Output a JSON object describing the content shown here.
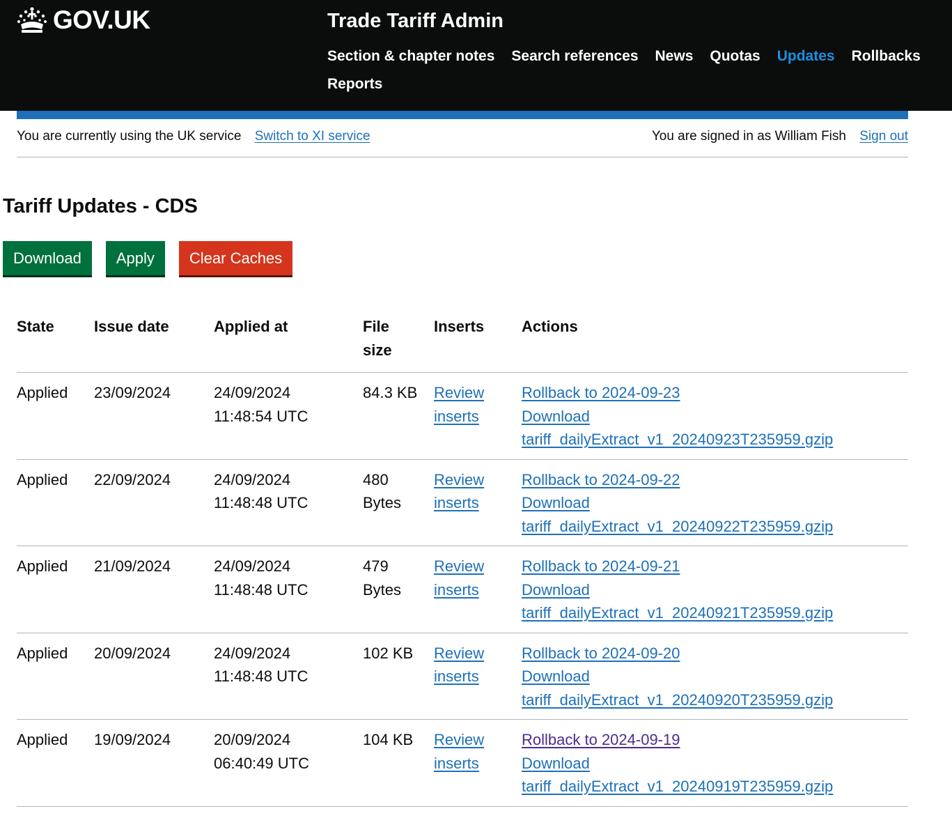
{
  "header": {
    "logo_text": "GOV.UK",
    "service_name": "Trade Tariff Admin",
    "nav": [
      {
        "label": "Section & chapter notes",
        "active": false
      },
      {
        "label": "Search references",
        "active": false
      },
      {
        "label": "News",
        "active": false
      },
      {
        "label": "Quotas",
        "active": false
      },
      {
        "label": "Updates",
        "active": true
      },
      {
        "label": "Rollbacks",
        "active": false
      },
      {
        "label": "Reports",
        "active": false
      }
    ]
  },
  "service_bar": {
    "current_service_text": "You are currently using the UK service",
    "switch_link": "Switch to XI service",
    "signed_in_text": "You are signed in as William Fish",
    "sign_out_link": "Sign out"
  },
  "page": {
    "title": "Tariff Updates - CDS",
    "buttons": {
      "download": "Download",
      "apply": "Apply",
      "clear_caches": "Clear Caches"
    }
  },
  "table": {
    "headers": {
      "state": "State",
      "issue_date": "Issue date",
      "applied_at": "Applied at",
      "file_size": "File size",
      "inserts": "Inserts",
      "actions": "Actions"
    },
    "rows": [
      {
        "state": "Applied",
        "issue_date": "23/09/2024",
        "applied_at": "24/09/2024 11:48:54 UTC",
        "file_size": "84.3 KB",
        "inserts_link": "Review inserts",
        "rollback_link": "Rollback to 2024-09-23",
        "download_link": "Download tariff_dailyExtract_v1_20240923T235959.gzip"
      },
      {
        "state": "Applied",
        "issue_date": "22/09/2024",
        "applied_at": "24/09/2024 11:48:48 UTC",
        "file_size": "480 Bytes",
        "inserts_link": "Review inserts",
        "rollback_link": "Rollback to 2024-09-22",
        "download_link": "Download tariff_dailyExtract_v1_20240922T235959.gzip"
      },
      {
        "state": "Applied",
        "issue_date": "21/09/2024",
        "applied_at": "24/09/2024 11:48:48 UTC",
        "file_size": "479 Bytes",
        "inserts_link": "Review inserts",
        "rollback_link": "Rollback to 2024-09-21",
        "download_link": "Download tariff_dailyExtract_v1_20240921T235959.gzip"
      },
      {
        "state": "Applied",
        "issue_date": "20/09/2024",
        "applied_at": "24/09/2024 11:48:48 UTC",
        "file_size": "102 KB",
        "inserts_link": "Review inserts",
        "rollback_link": "Rollback to 2024-09-20",
        "download_link": "Download tariff_dailyExtract_v1_20240920T235959.gzip"
      },
      {
        "state": "Applied",
        "issue_date": "19/09/2024",
        "applied_at": "20/09/2024 06:40:49 UTC",
        "file_size": "104 KB",
        "inserts_link": "Review inserts",
        "rollback_link": "Rollback to 2024-09-19",
        "download_link": "Download tariff_dailyExtract_v1_20240919T235959.gzip"
      }
    ]
  }
}
